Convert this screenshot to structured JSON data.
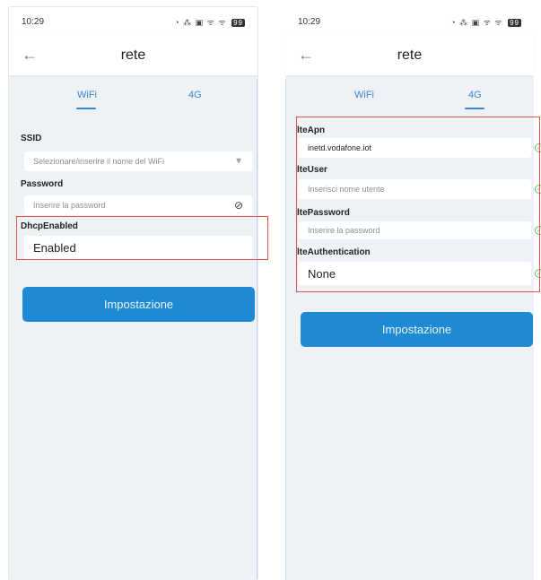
{
  "left": {
    "status_time": "10:29",
    "status_icons": "◔ ⁂ ▣ ᯤ ᯤ",
    "battery": "99",
    "title": "rete",
    "tabs": [
      {
        "label": "WiFi",
        "active": true
      },
      {
        "label": "4G",
        "active": false
      }
    ],
    "ssid_label": "SSID",
    "ssid_placeholder": "Selezionare/inserire il nome del WiFi",
    "password_label": "Password",
    "password_placeholder": "Inserire la password",
    "dhcp_label": "DhcpEnabled",
    "dhcp_value": "Enabled",
    "button_label": "Impostazione"
  },
  "right": {
    "status_time": "10:29",
    "status_icons": "◔ ⁂ ▣ ᯤ ᯤ",
    "battery": "99",
    "title": "rete",
    "tabs": [
      {
        "label": "WiFi",
        "active": false
      },
      {
        "label": "4G",
        "active": true
      }
    ],
    "apn_label": "lteApn",
    "apn_value": "inetd.vodafone.iot",
    "user_label": "lteUser",
    "user_placeholder": "Inserisci nome utente",
    "pass_label": "ltePassword",
    "pass_placeholder": "Inserire la password",
    "auth_label": "lteAuthentication",
    "auth_value": "None",
    "button_label": "Impostazione"
  },
  "colors": {
    "accent": "#1f8ad4",
    "highlight": "#e05545",
    "ok": "#5cc46b"
  }
}
